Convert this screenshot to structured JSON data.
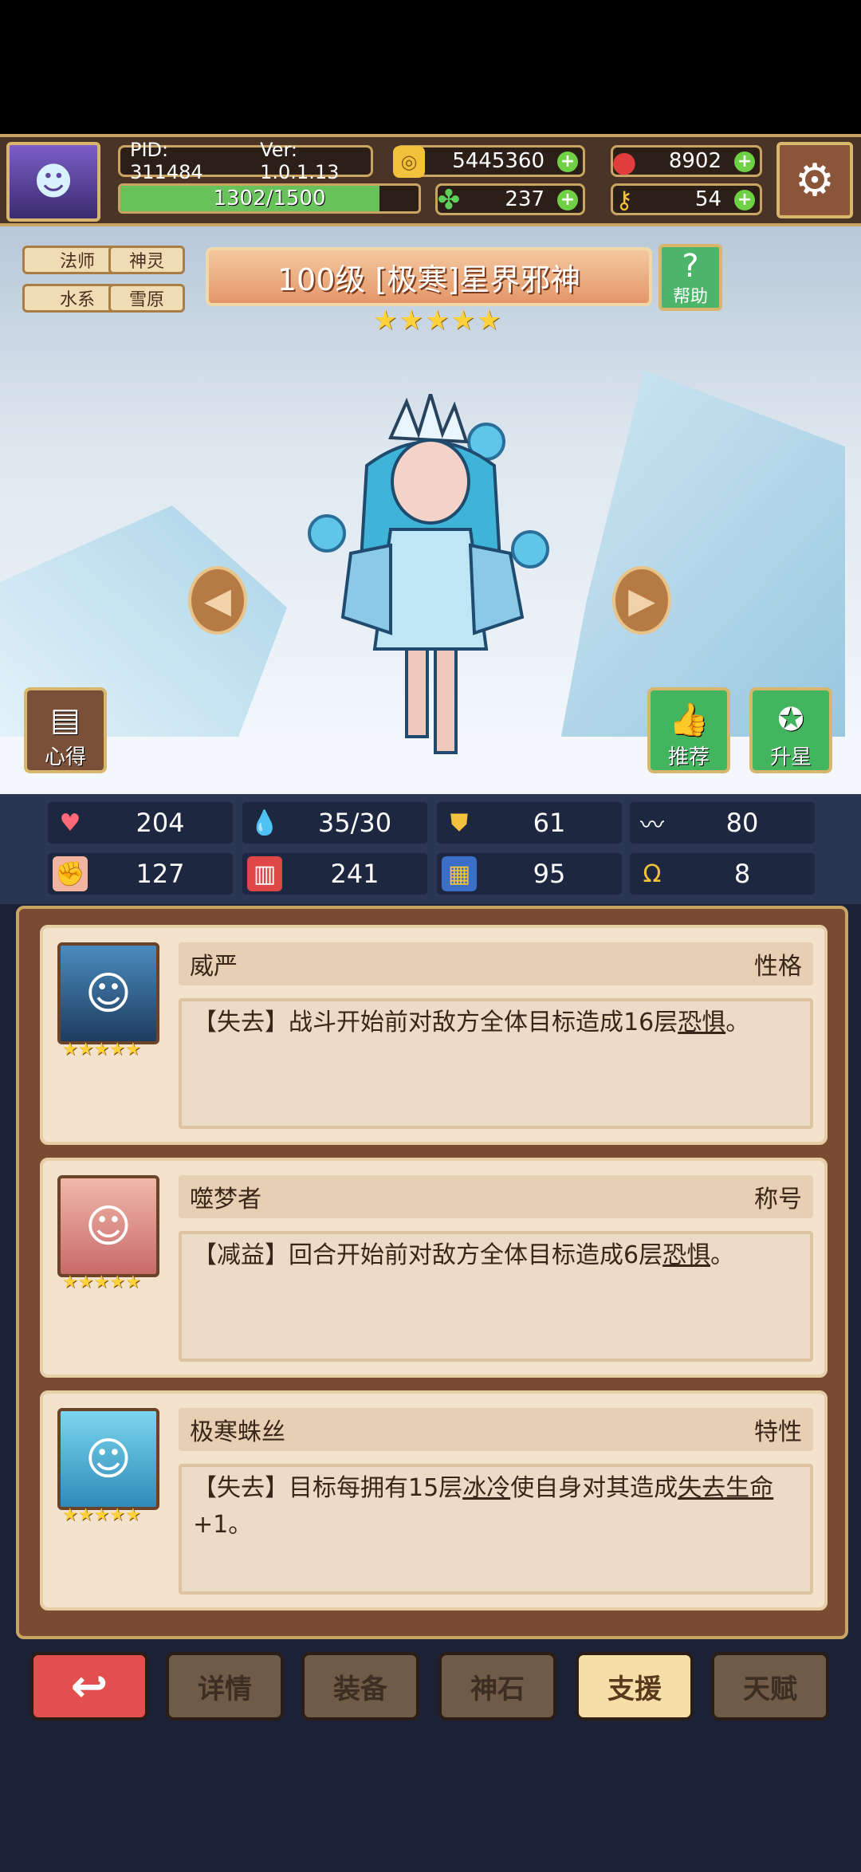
{
  "hud": {
    "pid": "PID: 311484",
    "version": "Ver: 1.0.1.13",
    "gold": "5445360",
    "gems": "8902",
    "clover": "237",
    "keys": "54",
    "xp": "1302/1500",
    "xp_fraction": 0.868
  },
  "tags": [
    "法师",
    "神灵",
    "水系",
    "雪原"
  ],
  "hero": {
    "title": "100级 [极寒]星界邪神",
    "stars": 5,
    "help_label": "帮助",
    "notes_label": "心得",
    "recommend_label": "推荐",
    "upgrade_label": "升星"
  },
  "stats": {
    "hp": "204",
    "mana": "35/30",
    "defense": "61",
    "speed": "80",
    "fist": "127",
    "book": "241",
    "shield2": "95",
    "horseshoe": "8"
  },
  "cards": [
    {
      "name": "威严",
      "type": "性格",
      "prefix": "【失去】",
      "text": "战斗开始前对敌方全体目标造成16层",
      "term": "恐惧",
      "suffix": "。"
    },
    {
      "name": "噬梦者",
      "type": "称号",
      "prefix": "【减益】",
      "text": "回合开始前对敌方全体目标造成6层",
      "term": "恐惧",
      "suffix": "。"
    },
    {
      "name": "极寒蛛丝",
      "type": "特性",
      "prefix": "【失去】",
      "text": "目标每拥有15层",
      "term": "冰冷",
      "text2": "使自身对其造成",
      "term2": "失去生命",
      "suffix": "+1。"
    }
  ],
  "nav": [
    "详情",
    "装备",
    "神石",
    "支援",
    "天赋"
  ],
  "colors": {
    "gold": "#ffd23c",
    "active_tab": "#f6dfa6",
    "back_button": "#e24f4f",
    "panel": "#7a4a33"
  }
}
